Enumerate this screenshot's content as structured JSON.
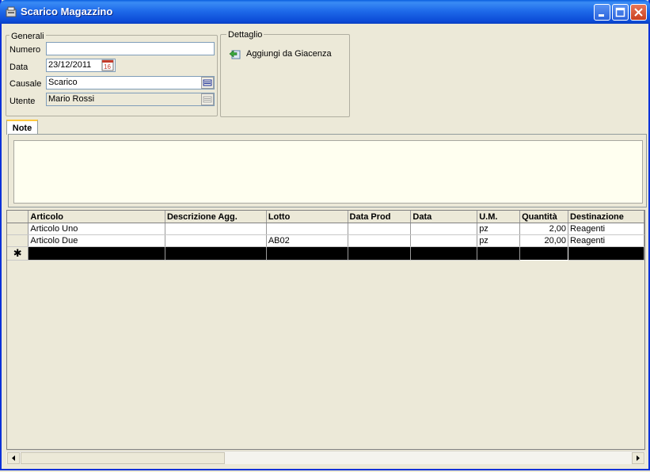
{
  "window": {
    "title": "Scarico Magazzino"
  },
  "generali": {
    "title": "Generali",
    "numero_label": "Numero",
    "numero_value": "",
    "data_label": "Data",
    "data_value": "23/12/2011",
    "causale_label": "Causale",
    "causale_value": "Scarico",
    "utente_label": "Utente",
    "utente_value": "Mario Rossi"
  },
  "dettaglio": {
    "title": "Dettaglio",
    "aggiungi_label": "Aggiungi da Giacenza"
  },
  "tabs": {
    "note": "Note"
  },
  "note": {
    "text": ""
  },
  "grid": {
    "columns": [
      "Articolo",
      "Descrizione Agg.",
      "Lotto",
      "Data Prod",
      "Data",
      "U.M.",
      "Quantità",
      "Destinazione"
    ],
    "rows": [
      [
        "Articolo Uno",
        "",
        "",
        "",
        "",
        "pz",
        "2,00",
        "Reagenti"
      ],
      [
        "Articolo Due",
        "",
        "AB02",
        "",
        "",
        "pz",
        "20,00",
        "Reagenti"
      ]
    ],
    "new_row_marker": "✱"
  }
}
